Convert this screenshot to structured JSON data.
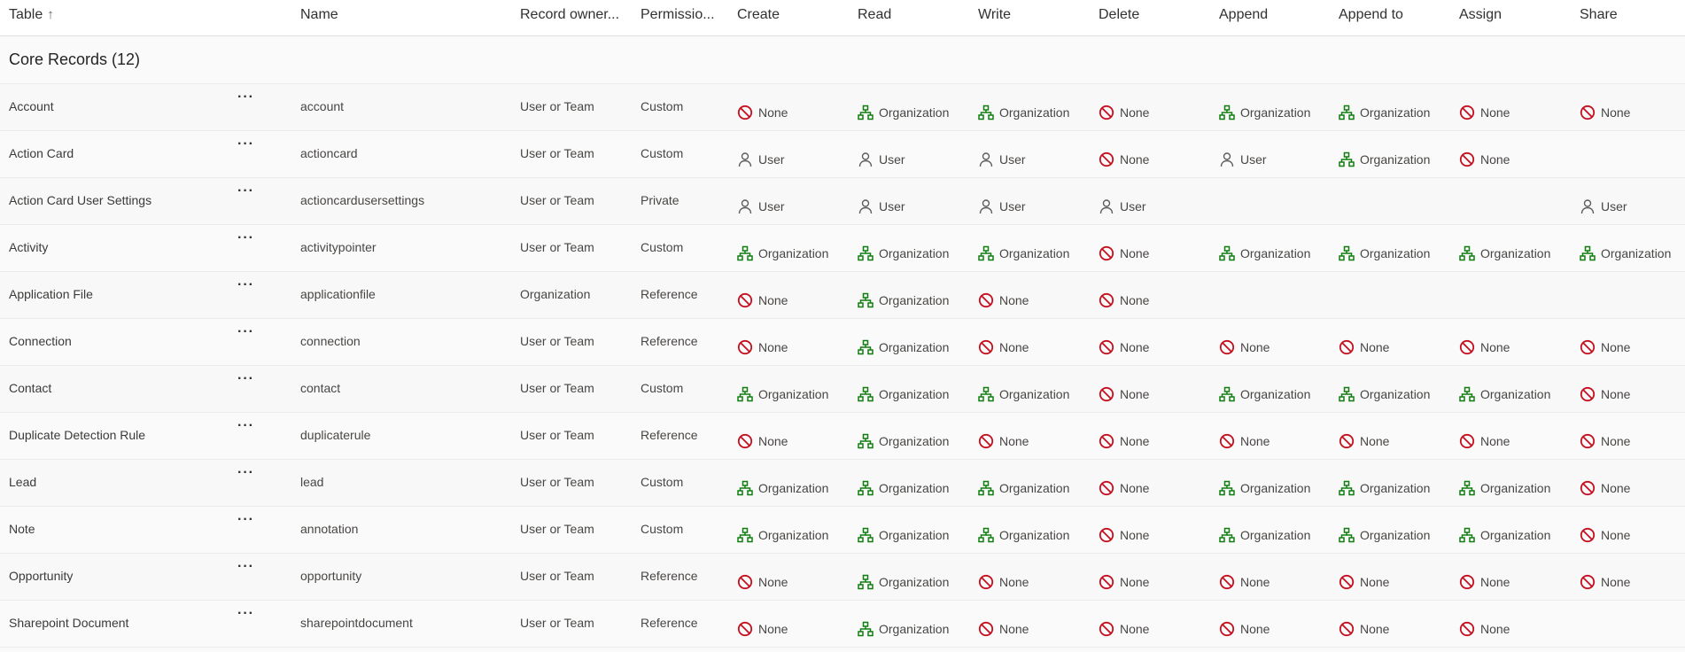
{
  "header": {
    "columns": [
      "Table",
      "Name",
      "Record owner...",
      "Permissio...",
      "Create",
      "Read",
      "Write",
      "Delete",
      "Append",
      "Append to",
      "Assign",
      "Share"
    ],
    "sort_indicator": "↑"
  },
  "group": {
    "label": "Core Records (12)"
  },
  "rows": [
    {
      "table": "Account",
      "name": "account",
      "owner": "User or Team",
      "permission": "Custom",
      "perms": [
        "None",
        "Organization",
        "Organization",
        "None",
        "Organization",
        "Organization",
        "None",
        "None"
      ]
    },
    {
      "table": "Action Card",
      "name": "actioncard",
      "owner": "User or Team",
      "permission": "Custom",
      "perms": [
        "User",
        "User",
        "User",
        "None",
        "User",
        "Organization",
        "None",
        ""
      ]
    },
    {
      "table": "Action Card User Settings",
      "name": "actioncardusersettings",
      "owner": "User or Team",
      "permission": "Private",
      "perms": [
        "User",
        "User",
        "User",
        "User",
        "",
        "",
        "",
        "User"
      ]
    },
    {
      "table": "Activity",
      "name": "activitypointer",
      "owner": "User or Team",
      "permission": "Custom",
      "perms": [
        "Organization",
        "Organization",
        "Organization",
        "None",
        "Organization",
        "Organization",
        "Organization",
        "Organization"
      ]
    },
    {
      "table": "Application File",
      "name": "applicationfile",
      "owner": "Organization",
      "permission": "Reference",
      "perms": [
        "None",
        "Organization",
        "None",
        "None",
        "",
        "",
        "",
        ""
      ]
    },
    {
      "table": "Connection",
      "name": "connection",
      "owner": "User or Team",
      "permission": "Reference",
      "perms": [
        "None",
        "Organization",
        "None",
        "None",
        "None",
        "None",
        "None",
        "None"
      ]
    },
    {
      "table": "Contact",
      "name": "contact",
      "owner": "User or Team",
      "permission": "Custom",
      "perms": [
        "Organization",
        "Organization",
        "Organization",
        "None",
        "Organization",
        "Organization",
        "Organization",
        "None"
      ]
    },
    {
      "table": "Duplicate Detection Rule",
      "name": "duplicaterule",
      "owner": "User or Team",
      "permission": "Reference",
      "perms": [
        "None",
        "Organization",
        "None",
        "None",
        "None",
        "None",
        "None",
        "None"
      ]
    },
    {
      "table": "Lead",
      "name": "lead",
      "owner": "User or Team",
      "permission": "Custom",
      "perms": [
        "Organization",
        "Organization",
        "Organization",
        "None",
        "Organization",
        "Organization",
        "Organization",
        "None"
      ]
    },
    {
      "table": "Note",
      "name": "annotation",
      "owner": "User or Team",
      "permission": "Custom",
      "perms": [
        "Organization",
        "Organization",
        "Organization",
        "None",
        "Organization",
        "Organization",
        "Organization",
        "None"
      ]
    },
    {
      "table": "Opportunity",
      "name": "opportunity",
      "owner": "User or Team",
      "permission": "Reference",
      "perms": [
        "None",
        "Organization",
        "None",
        "None",
        "None",
        "None",
        "None",
        "None"
      ]
    },
    {
      "table": "Sharepoint Document",
      "name": "sharepointdocument",
      "owner": "User or Team",
      "permission": "Reference",
      "perms": [
        "None",
        "Organization",
        "None",
        "None",
        "None",
        "None",
        "None",
        ""
      ]
    }
  ],
  "more_label": "···",
  "icons": {
    "None": "none-icon",
    "Organization": "organization-icon",
    "User": "user-icon"
  },
  "colors": {
    "none": "#c50f1f",
    "organization": "#107c10",
    "user": "#605e5c"
  }
}
